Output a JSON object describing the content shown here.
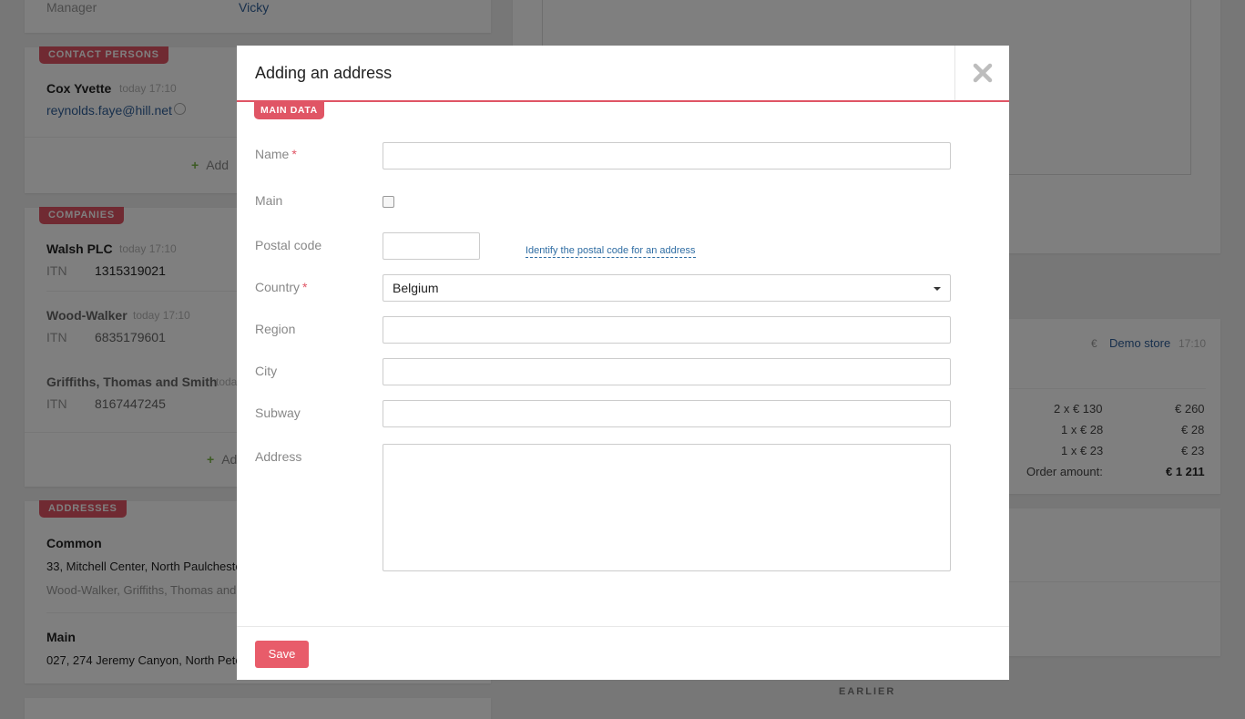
{
  "background": {
    "manager": {
      "label": "Manager",
      "value": "Vicky"
    },
    "contact_persons": {
      "tag": "CONTACT PERSONS",
      "name": "Cox Yvette",
      "time": "today 17:10",
      "email": "reynolds.faye@hill.net",
      "add_label": "Add"
    },
    "companies": {
      "tag": "COMPANIES",
      "items": [
        {
          "name": "Walsh PLC",
          "time": "today 17:10",
          "itn_label": "ITN",
          "itn": "1315319021"
        },
        {
          "name": "Wood-Walker",
          "time": "today 17:10",
          "itn_label": "ITN",
          "itn": "6835179601"
        },
        {
          "name": "Griffiths, Thomas and Smith",
          "time": "toda",
          "itn_label": "ITN",
          "itn": "8167447245"
        }
      ],
      "add_label": "Ad"
    },
    "addresses": {
      "tag": "ADDRESSES",
      "items": [
        {
          "title": "Common",
          "line": "33, Mitchell Center, North Paulcheste",
          "sub": "Wood-Walker, Griffiths, Thomas and"
        },
        {
          "title": "Main",
          "line": "027, 274 Jeremy Canyon, North Pete"
        }
      ]
    },
    "order": {
      "store": "Demo store",
      "time": "17:10",
      "lines": [
        {
          "qty": "2 x € 130",
          "sum": "€ 260"
        },
        {
          "qty": "1 x € 28",
          "sum": "€ 28"
        },
        {
          "qty": "1 x € 23",
          "sum": "€ 23"
        }
      ],
      "amount_label": "Order amount:",
      "amount": "€ 1 211"
    },
    "earlier": "EARLIER"
  },
  "modal": {
    "title": "Adding an address",
    "tag": "MAIN DATA",
    "fields": {
      "name": {
        "label": "Name",
        "value": ""
      },
      "main": {
        "label": "Main",
        "checked": false
      },
      "postal_code": {
        "label": "Postal code",
        "value": "",
        "link": "Identify the postal code for an address"
      },
      "country": {
        "label": "Country",
        "value": "Belgium"
      },
      "region": {
        "label": "Region",
        "value": ""
      },
      "city": {
        "label": "City",
        "value": ""
      },
      "subway": {
        "label": "Subway",
        "value": ""
      },
      "address": {
        "label": "Address",
        "value": ""
      }
    },
    "required_mark": "*",
    "save_label": "Save"
  },
  "colors": {
    "accent": "#e05565",
    "link": "#2f6da3",
    "overlay": "rgba(0,0,0,0.5)"
  }
}
